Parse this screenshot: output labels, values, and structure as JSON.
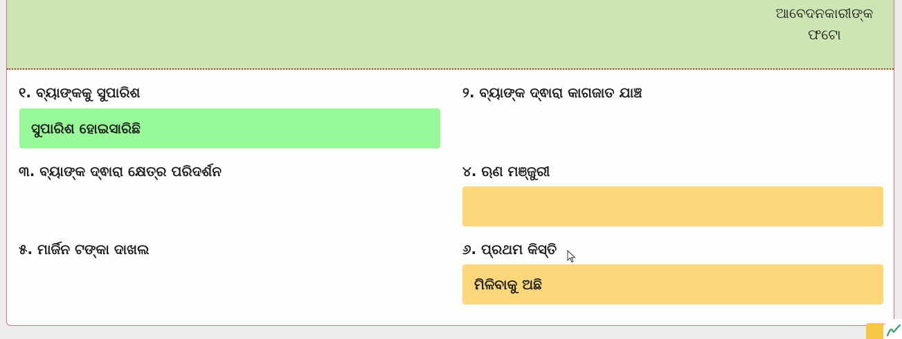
{
  "header": {
    "photo_label_line1": "ଆବେଦନକାରୀଙ୍କ",
    "photo_label_line2": "ଫଟୋ"
  },
  "steps": [
    {
      "label": "୧. ବ୍ୟାଙ୍କକୁ ସୁପାରିଶ",
      "status": "ସୁପାରିଶ ହୋଇସାରିଛି",
      "status_color": "#98f998"
    },
    {
      "label": "୨. ବ୍ୟାଙ୍କ ଦ୍ଵାରା କାଗଜାତ ଯାଞ୍ଚ",
      "status": ""
    },
    {
      "label": "୩. ବ୍ୟାଙ୍କ ଦ୍ଵାରା କ୍ଷେତ୍ର ପରିଦର୍ଶନ",
      "status": ""
    },
    {
      "label": "୪. ଋଣ ମଞ୍ଜୁରୀ",
      "status": "",
      "status_color": "#fbd779"
    },
    {
      "label": "୫. ମାର୍ଜିନ ଟଙ୍କା ଦାଖଲ",
      "status": ""
    },
    {
      "label": "୬. ପ୍ରଥମ କିସ୍ତି",
      "status": "ମିଳିବାକୁ ଅଛି",
      "status_color": "#fbd779"
    }
  ],
  "icons": {
    "cursor": "mouse-pointer-icon",
    "corner": "checkmark-signature-icon"
  }
}
